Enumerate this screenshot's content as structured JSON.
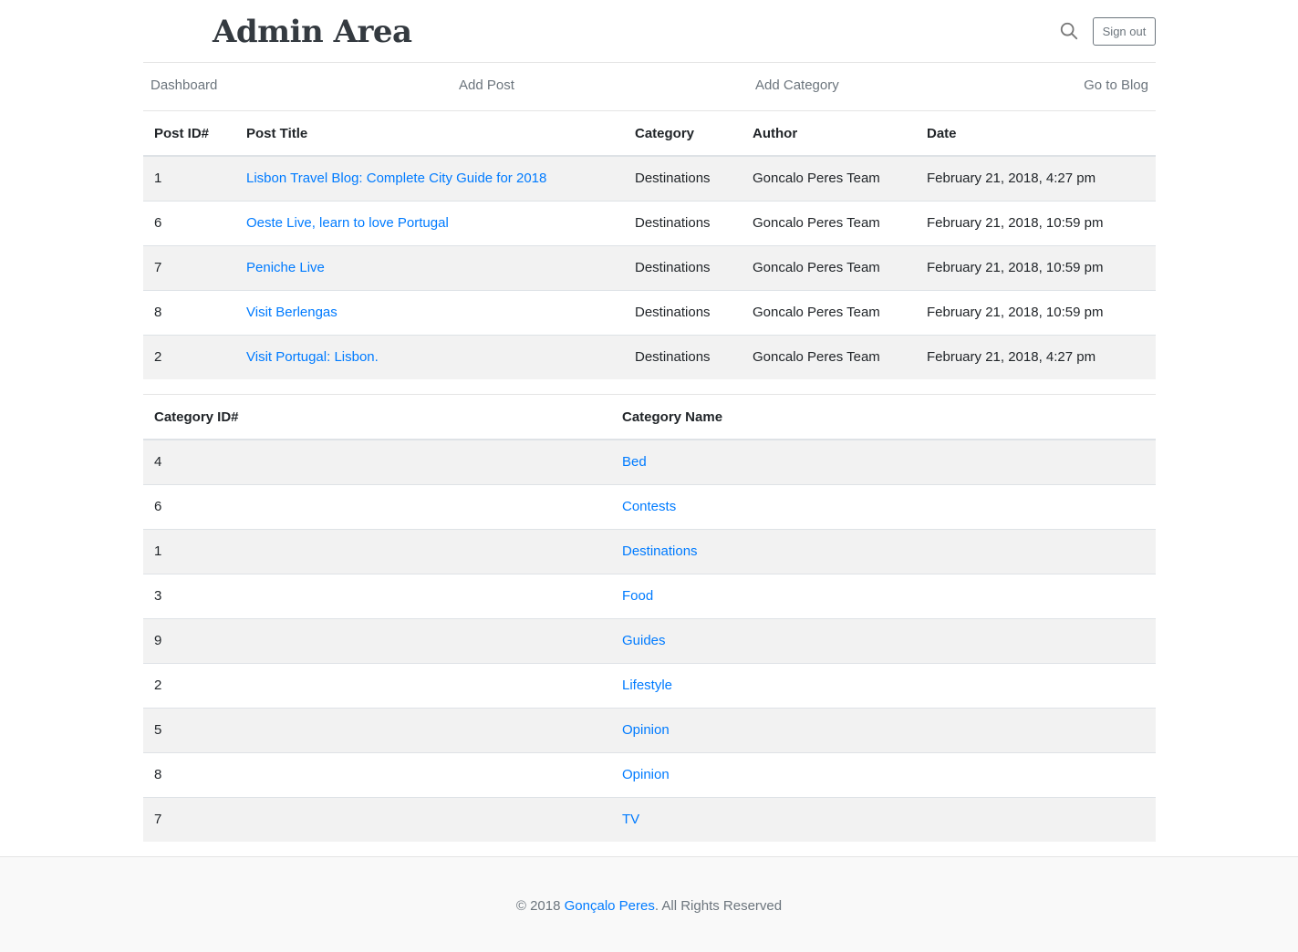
{
  "header": {
    "brand": "Admin Area",
    "signout_label": "Sign out"
  },
  "nav": [
    "Dashboard",
    "Add Post",
    "Add Category",
    "Go to Blog"
  ],
  "posts_table": {
    "columns": [
      "Post ID#",
      "Post Title",
      "Category",
      "Author",
      "Date"
    ],
    "rows": [
      {
        "id": "1",
        "title": "Lisbon Travel Blog: Complete City Guide for 2018",
        "category": "Destinations",
        "author": "Goncalo Peres Team",
        "date": "February 21, 2018, 4:27 pm"
      },
      {
        "id": "6",
        "title": "Oeste Live, learn to love Portugal",
        "category": "Destinations",
        "author": "Goncalo Peres Team",
        "date": "February 21, 2018, 10:59 pm"
      },
      {
        "id": "7",
        "title": "Peniche Live",
        "category": "Destinations",
        "author": "Goncalo Peres Team",
        "date": "February 21, 2018, 10:59 pm"
      },
      {
        "id": "8",
        "title": "Visit Berlengas",
        "category": "Destinations",
        "author": "Goncalo Peres Team",
        "date": "February 21, 2018, 10:59 pm"
      },
      {
        "id": "2",
        "title": "Visit Portugal: Lisbon.",
        "category": "Destinations",
        "author": "Goncalo Peres Team",
        "date": "February 21, 2018, 4:27 pm"
      }
    ]
  },
  "categories_table": {
    "columns": [
      "Category ID#",
      "Category Name"
    ],
    "rows": [
      {
        "id": "4",
        "name": "Bed"
      },
      {
        "id": "6",
        "name": "Contests"
      },
      {
        "id": "1",
        "name": "Destinations"
      },
      {
        "id": "3",
        "name": "Food"
      },
      {
        "id": "9",
        "name": "Guides"
      },
      {
        "id": "2",
        "name": "Lifestyle"
      },
      {
        "id": "5",
        "name": "Opinion"
      },
      {
        "id": "8",
        "name": "Opinion"
      },
      {
        "id": "7",
        "name": "TV"
      }
    ]
  },
  "footer": {
    "prefix": "© 2018 ",
    "link": "Gonçalo Peres",
    "suffix": ". All Rights Reserved"
  },
  "colors": {
    "link": "#007bff",
    "muted": "#6c757d",
    "stripe": "#f2f2f2"
  }
}
